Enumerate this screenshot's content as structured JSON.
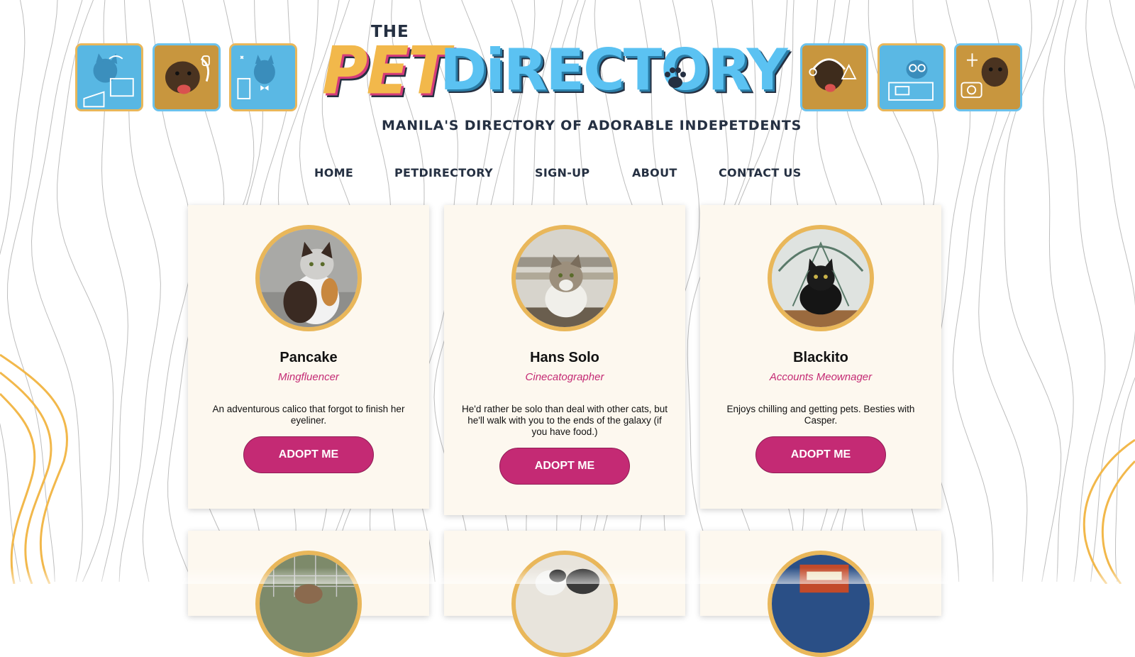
{
  "header": {
    "logo": {
      "the": "THE",
      "pet": "PET",
      "directory": "DiRECTORY",
      "tagline": "MANILA'S DIRECTORY OF ADORABLE INDEPETDENTS"
    },
    "thumbnails_left": [
      "cat-on-laptop",
      "dog-with-phone",
      "cat-with-bowtie"
    ],
    "thumbnails_right": [
      "dog-with-headset",
      "cat-with-glasses",
      "dog-with-camera"
    ]
  },
  "nav": {
    "items": [
      "HOME",
      "PETDIRECTORY",
      "SIGN-UP",
      "ABOUT",
      "CONTACT US"
    ]
  },
  "cards": [
    {
      "name": "Pancake",
      "role": "Mingfluencer",
      "description": "An adventurous calico that forgot to finish her eyeliner.",
      "button": "ADOPT ME"
    },
    {
      "name": "Hans Solo",
      "role": "Cinecatographer",
      "description": "He'd rather be solo than deal with other cats, but he'll walk with you to the ends of the galaxy (if you have food.)",
      "button": "ADOPT ME"
    },
    {
      "name": "Blackito",
      "role": "Accounts Meownager",
      "description": "Enjoys chilling and getting pets. Besties with Casper.",
      "button": "ADOPT ME"
    }
  ],
  "colors": {
    "accent_pink": "#c42a74",
    "accent_gold": "#e9b75a",
    "accent_blue": "#5bc2f2",
    "card_bg": "#fdf8ef",
    "nav_text": "#253042"
  }
}
